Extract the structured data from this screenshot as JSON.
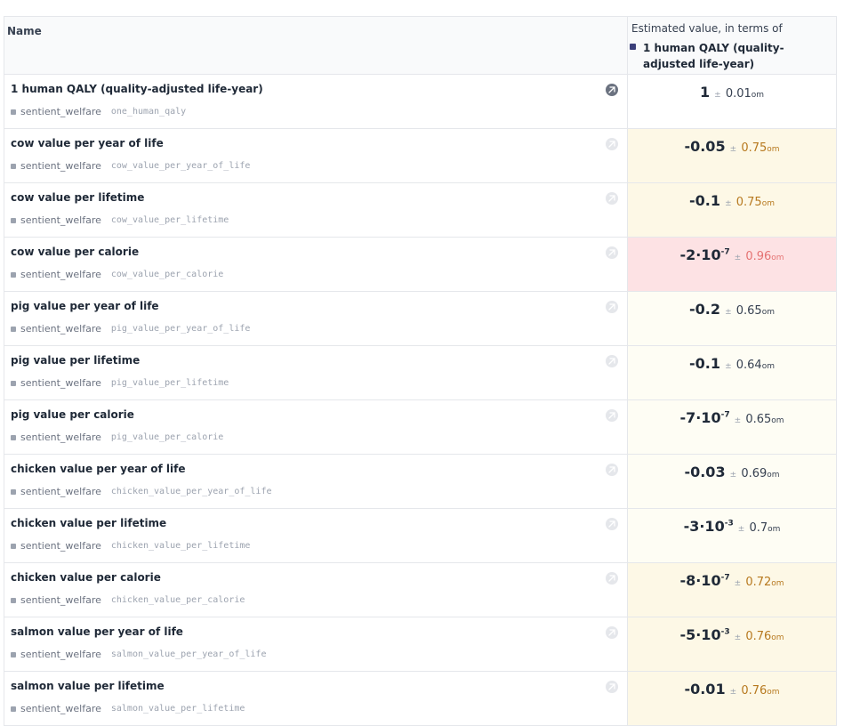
{
  "header": {
    "name_label": "Name",
    "estimate_label": "Estimated value, in terms of",
    "reference_item": "1 human QALY (quality-adjusted life-year)"
  },
  "rows": [
    {
      "name": "1 human QALY (quality-adjusted life-year)",
      "module": "sentient_welfare",
      "var": "one_human_qaly",
      "value": "1",
      "exp": "",
      "unc": "0.01",
      "unit": "om",
      "bg": "#ffffff",
      "unc_color": "#374151",
      "active": true
    },
    {
      "name": "cow value per year of life",
      "module": "sentient_welfare",
      "var": "cow_value_per_year_of_life",
      "value": "-0.05",
      "exp": "",
      "unc": "0.75",
      "unit": "om",
      "bg": "#fdf8e6",
      "unc_color": "#b7791f",
      "active": false
    },
    {
      "name": "cow value per lifetime",
      "module": "sentient_welfare",
      "var": "cow_value_per_lifetime",
      "value": "-0.1",
      "exp": "",
      "unc": "0.75",
      "unit": "om",
      "bg": "#fdf8e6",
      "unc_color": "#b7791f",
      "active": false
    },
    {
      "name": "cow value per calorie",
      "module": "sentient_welfare",
      "var": "cow_value_per_calorie",
      "value": "-2·10",
      "exp": "-7",
      "unc": "0.96",
      "unit": "om",
      "bg": "#fde2e4",
      "unc_color": "#e57373",
      "active": false
    },
    {
      "name": "pig value per year of life",
      "module": "sentient_welfare",
      "var": "pig_value_per_year_of_life",
      "value": "-0.2",
      "exp": "",
      "unc": "0.65",
      "unit": "om",
      "bg": "#fefdf4",
      "unc_color": "#374151",
      "active": false
    },
    {
      "name": "pig value per lifetime",
      "module": "sentient_welfare",
      "var": "pig_value_per_lifetime",
      "value": "-0.1",
      "exp": "",
      "unc": "0.64",
      "unit": "om",
      "bg": "#fefdf4",
      "unc_color": "#374151",
      "active": false
    },
    {
      "name": "pig value per calorie",
      "module": "sentient_welfare",
      "var": "pig_value_per_calorie",
      "value": "-7·10",
      "exp": "-7",
      "unc": "0.65",
      "unit": "om",
      "bg": "#fefdf4",
      "unc_color": "#374151",
      "active": false
    },
    {
      "name": "chicken value per year of life",
      "module": "sentient_welfare",
      "var": "chicken_value_per_year_of_life",
      "value": "-0.03",
      "exp": "",
      "unc": "0.69",
      "unit": "om",
      "bg": "#fefdf4",
      "unc_color": "#374151",
      "active": false
    },
    {
      "name": "chicken value per lifetime",
      "module": "sentient_welfare",
      "var": "chicken_value_per_lifetime",
      "value": "-3·10",
      "exp": "-3",
      "unc": "0.7",
      "unit": "om",
      "bg": "#fefdf4",
      "unc_color": "#374151",
      "active": false
    },
    {
      "name": "chicken value per calorie",
      "module": "sentient_welfare",
      "var": "chicken_value_per_calorie",
      "value": "-8·10",
      "exp": "-7",
      "unc": "0.72",
      "unit": "om",
      "bg": "#fdf8e6",
      "unc_color": "#b7791f",
      "active": false
    },
    {
      "name": "salmon value per year of life",
      "module": "sentient_welfare",
      "var": "salmon_value_per_year_of_life",
      "value": "-5·10",
      "exp": "-3",
      "unc": "0.76",
      "unit": "om",
      "bg": "#fdf8e6",
      "unc_color": "#b7791f",
      "active": false
    },
    {
      "name": "salmon value per lifetime",
      "module": "sentient_welfare",
      "var": "salmon_value_per_lifetime",
      "value": "-0.01",
      "exp": "",
      "unc": "0.76",
      "unit": "om",
      "bg": "#fdf8e6",
      "unc_color": "#b7791f",
      "active": false
    }
  ]
}
